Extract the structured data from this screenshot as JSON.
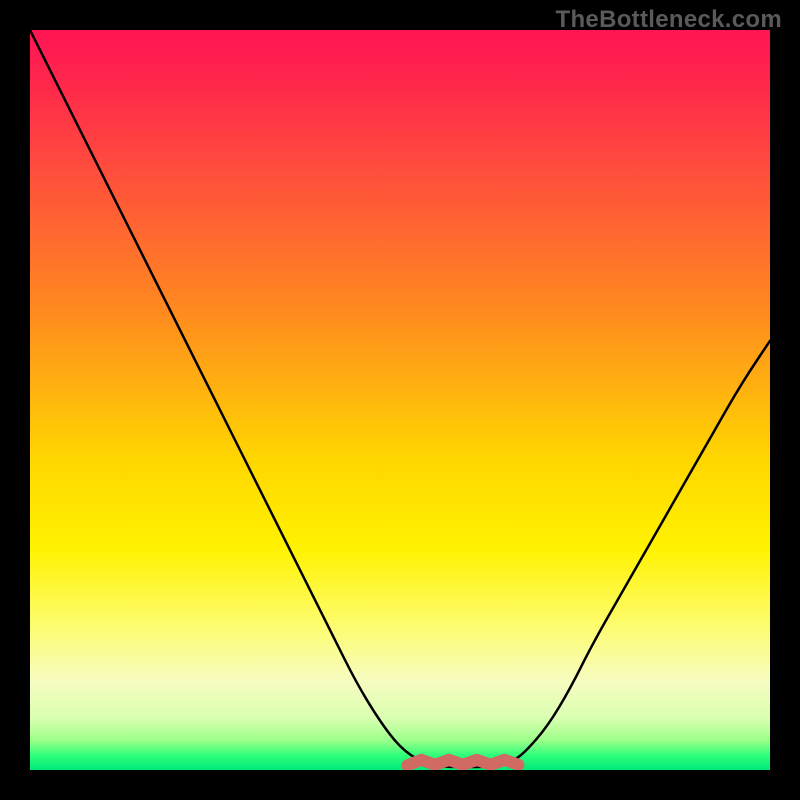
{
  "watermark": "TheBottleneck.com",
  "colors": {
    "background": "#000000",
    "curve": "#000000",
    "bottom_mark": "#d16a63",
    "gradient_stops": [
      "#ff1454",
      "#ff2a4a",
      "#ff4a3e",
      "#ff6a2f",
      "#ff8a1f",
      "#ffb010",
      "#ffd600",
      "#fff200",
      "#fdfc6a",
      "#f7fcc0",
      "#d9ffb0",
      "#9cff8a",
      "#2fff7a",
      "#00e87a"
    ]
  },
  "chart_data": {
    "type": "line",
    "title": "",
    "xlabel": "",
    "ylabel": "",
    "xlim": [
      0,
      100
    ],
    "ylim": [
      0,
      100
    ],
    "x": [
      0,
      2,
      5,
      8,
      11,
      14,
      17,
      20,
      23,
      26,
      29,
      32,
      35,
      38,
      41,
      44,
      47,
      50,
      53,
      55,
      57,
      59,
      61,
      63,
      65,
      67,
      70,
      73,
      76,
      80,
      84,
      88,
      92,
      96,
      100
    ],
    "values": [
      100,
      96,
      90,
      84,
      78,
      72,
      66,
      60,
      54,
      48,
      42,
      36,
      30,
      24,
      18,
      12,
      7,
      3,
      1,
      0.5,
      0.4,
      0.4,
      0.4,
      0.5,
      1,
      2.5,
      6,
      11,
      17,
      24,
      31,
      38,
      45,
      52,
      58
    ],
    "bottom_mark_range": {
      "x_start": 51,
      "x_end": 66,
      "y": 0.5
    },
    "annotations": []
  }
}
